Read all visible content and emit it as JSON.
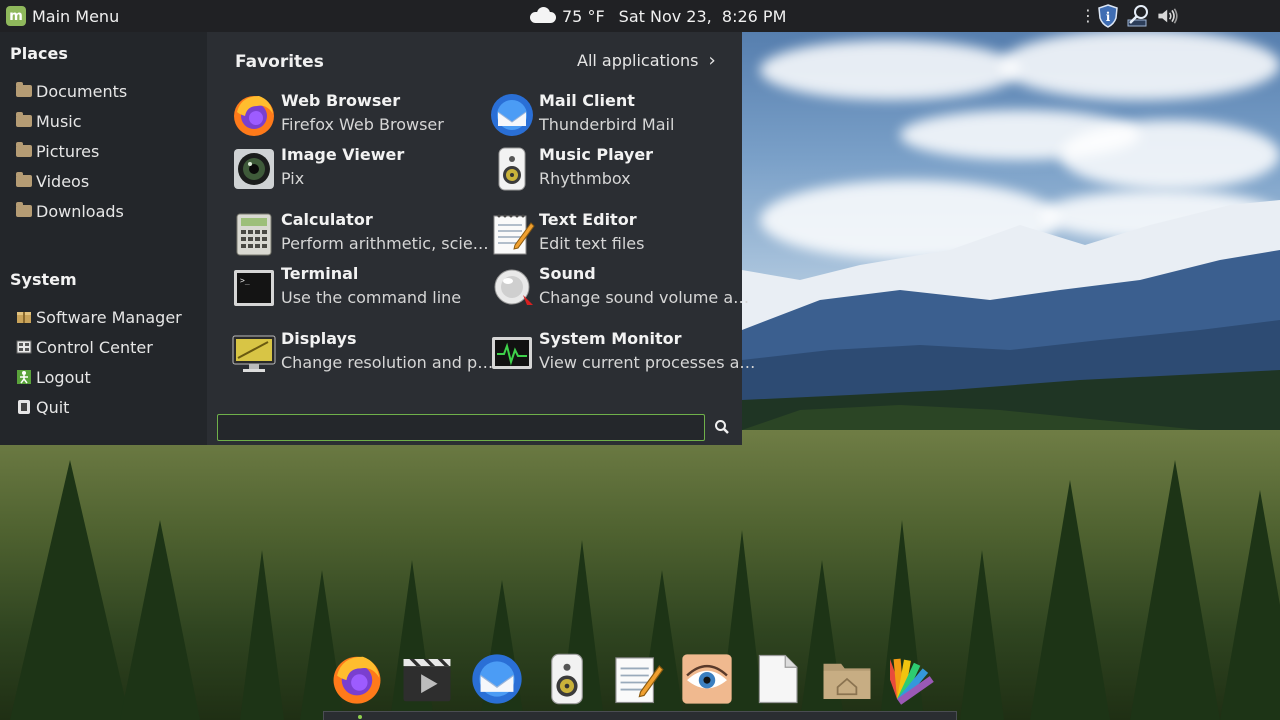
{
  "panel": {
    "menu_label": "Main Menu",
    "logo_letter": "m",
    "weather": "75 °F",
    "datetime": "Sat Nov 23,  8:26 PM",
    "tray_icons": [
      "more-dots-icon",
      "shield-info-icon",
      "network-search-icon",
      "volume-icon"
    ]
  },
  "sidebar": {
    "places_heading": "Places",
    "places": [
      {
        "label": "Documents",
        "icon": "folder-icon"
      },
      {
        "label": "Music",
        "icon": "folder-icon"
      },
      {
        "label": "Pictures",
        "icon": "folder-icon"
      },
      {
        "label": "Videos",
        "icon": "folder-icon"
      },
      {
        "label": "Downloads",
        "icon": "folder-icon"
      }
    ],
    "system_heading": "System",
    "system": [
      {
        "label": "Software Manager",
        "icon": "package-icon"
      },
      {
        "label": "Control Center",
        "icon": "settings-icon"
      },
      {
        "label": "Logout",
        "icon": "logout-icon"
      },
      {
        "label": "Quit",
        "icon": "power-icon"
      }
    ]
  },
  "favorites": {
    "title": "Favorites",
    "all_apps": "All applications",
    "apps": [
      {
        "name": "Web Browser",
        "desc": "Firefox Web Browser",
        "icon": "firefox-icon"
      },
      {
        "name": "Mail Client",
        "desc": "Thunderbird Mail",
        "icon": "thunderbird-icon"
      },
      {
        "name": "Image Viewer",
        "desc": "Pix",
        "icon": "camera-lens-icon"
      },
      {
        "name": "Music Player",
        "desc": "Rhythmbox",
        "icon": "speaker-icon"
      },
      {
        "name": "Calculator",
        "desc": "Perform arithmetic, scie…",
        "icon": "calculator-icon"
      },
      {
        "name": "Text Editor",
        "desc": "Edit text files",
        "icon": "notepad-icon"
      },
      {
        "name": "Terminal",
        "desc": "Use the command line",
        "icon": "terminal-icon"
      },
      {
        "name": "Sound",
        "desc": "Change sound volume a…",
        "icon": "sound-icon"
      },
      {
        "name": "Displays",
        "desc": "Change resolution and p…",
        "icon": "display-icon"
      },
      {
        "name": "System Monitor",
        "desc": "View current processes a…",
        "icon": "system-monitor-icon"
      }
    ]
  },
  "search": {
    "value": "",
    "placeholder": ""
  },
  "dock": [
    "firefox-icon",
    "video-player-icon",
    "thunderbird-icon",
    "speaker-icon",
    "notepad-icon",
    "eye-icon",
    "document-icon",
    "home-folder-icon",
    "color-palette-icon"
  ]
}
